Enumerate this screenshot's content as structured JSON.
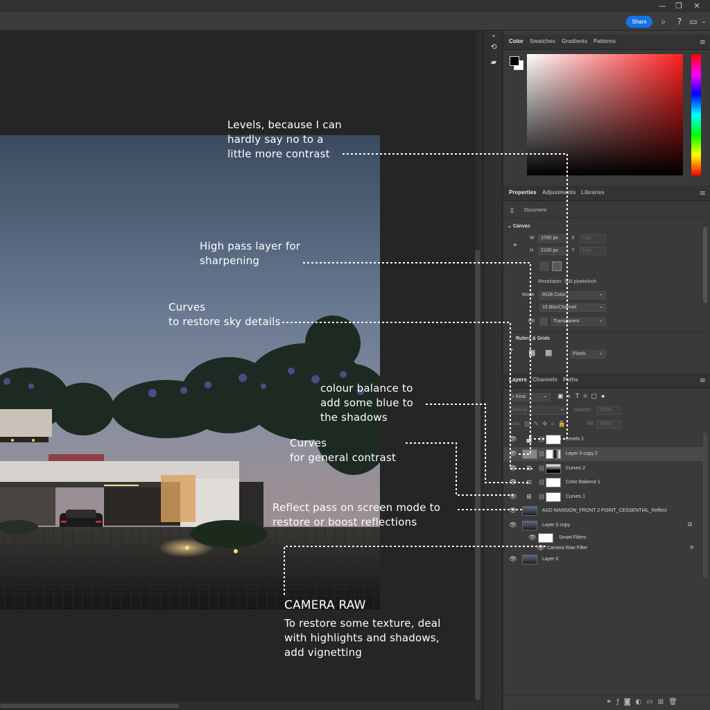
{
  "window": {
    "minimize_glyph": "—",
    "restore_glyph": "❐",
    "close_glyph": "✕"
  },
  "header": {
    "share_label": "Share",
    "icons": [
      "search-icon",
      "help-icon",
      "workspace-icon"
    ]
  },
  "color_panel": {
    "tabs": [
      "Color",
      "Swatches",
      "Gradients",
      "Patterns"
    ],
    "active_tab": "Color",
    "foreground": "#000000",
    "background": "#ffffff"
  },
  "properties_panel": {
    "tabs": [
      "Properties",
      "Adjustments",
      "Libraries"
    ],
    "active_tab": "Properties",
    "document_label": "Document",
    "canvas_section": "Canvas",
    "width_label": "W",
    "width_value": "3780 px",
    "height_label": "H",
    "height_value": "2100 px",
    "x_label": "X",
    "x_value": "0 px",
    "y_label": "Y",
    "y_value": "0 px",
    "resolution_label": "Resolution:",
    "resolution_value": "300 pixels/inch",
    "mode_label": "Mode",
    "mode_value": "RGB Color",
    "depth_value": "16 Bits/Channel",
    "fill_label": "Fill",
    "fill_value": "Transparent",
    "rulers_section": "Rulers & Grids",
    "units_value": "Pixels"
  },
  "layers_panel": {
    "tabs": [
      "Layers",
      "Channels",
      "Paths"
    ],
    "active_tab": "Layers",
    "filter_kind": "Kind",
    "blend_mode": "Normal",
    "opacity_label": "Opacity:",
    "opacity_value": "100%",
    "lock_label": "Lock:",
    "fill_label": "Fill:",
    "fill_value": "100%",
    "layers": [
      {
        "name": "Levels 1",
        "type": "adjustment",
        "icon": "levels-icon"
      },
      {
        "name": "Layer 0 copy 2",
        "type": "pixel-masked",
        "icon": "highpass-thumb"
      },
      {
        "name": "Curves 2",
        "type": "adjustment",
        "icon": "curves-icon"
      },
      {
        "name": "Color Balance 1",
        "type": "adjustment",
        "icon": "color-balance-icon"
      },
      {
        "name": "Curves 1",
        "type": "adjustment",
        "icon": "curves-icon"
      },
      {
        "name": "ASO MANSION_FRONT 2 POINT_CESSENTIAL_Reflect",
        "type": "pixel",
        "icon": "image-thumb"
      },
      {
        "name": "Layer 0 copy",
        "type": "smart-object",
        "icon": "image-thumb"
      },
      {
        "name": "Smart Filters",
        "type": "smart-filters",
        "icon": "filter-mask"
      },
      {
        "name": "Camera Raw Filter",
        "type": "filter",
        "icon": "filter-icon"
      },
      {
        "name": "Layer 0",
        "type": "pixel",
        "icon": "image-thumb"
      }
    ]
  },
  "annotations": {
    "levels": [
      "Levels, because I can",
      "hardly say no to a",
      "little more contrast"
    ],
    "highpass": [
      "High pass layer for",
      "sharpening"
    ],
    "curves_sky": [
      "Curves",
      "to restore sky details"
    ],
    "color_balance": [
      "colour balance to",
      "add some blue to",
      "the shadows"
    ],
    "curves_general": [
      "Curves",
      "for general contrast"
    ],
    "reflect": [
      "Reflect pass on screen mode to",
      "restore or boost reflections"
    ],
    "camera_raw_title": "CAMERA RAW",
    "camera_raw": [
      "To restore some texture, deal",
      "with highlights and shadows,",
      "add vignetting"
    ]
  },
  "colors": {
    "annotation_text": "#ffffff",
    "share_button": "#1473e6",
    "panel_bg": "#3a3a3a",
    "canvas_bg": "#252525"
  }
}
